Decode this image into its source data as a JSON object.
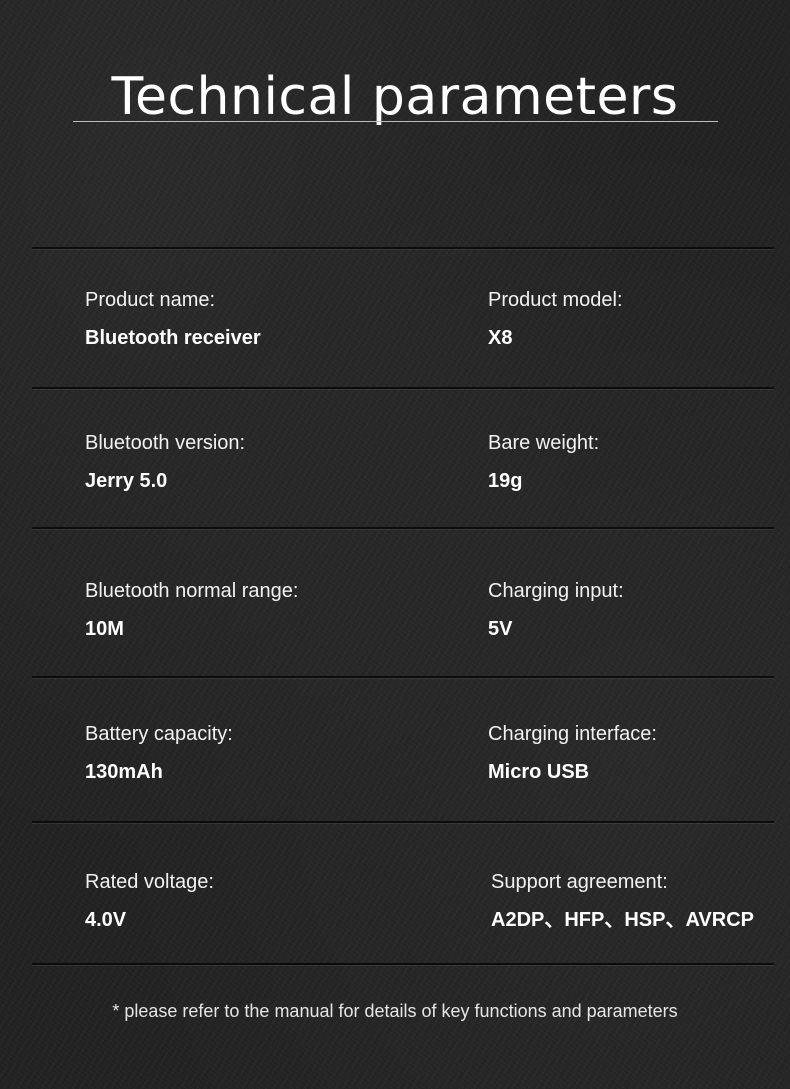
{
  "title": "Technical parameters",
  "rows": [
    {
      "left": {
        "label": "Product name:",
        "value": "Bluetooth receiver"
      },
      "right": {
        "label": "Product model:",
        "value": "X8"
      }
    },
    {
      "left": {
        "label": "Bluetooth version:",
        "value": "Jerry 5.0"
      },
      "right": {
        "label": "Bare weight:",
        "value": "19g"
      }
    },
    {
      "left": {
        "label": "Bluetooth normal range:",
        "value": "10M"
      },
      "right": {
        "label": "Charging input:",
        "value": "5V"
      }
    },
    {
      "left": {
        "label": "Battery capacity:",
        "value": "130mAh"
      },
      "right": {
        "label": "Charging interface:",
        "value": "Micro USB"
      }
    },
    {
      "left": {
        "label": "Rated voltage:",
        "value": "4.0V"
      },
      "right": {
        "label": "Support agreement:",
        "value": "A2DP、HFP、HSP、AVRCP"
      }
    }
  ],
  "footnote": "* please refer to the manual for details of key functions and parameters"
}
